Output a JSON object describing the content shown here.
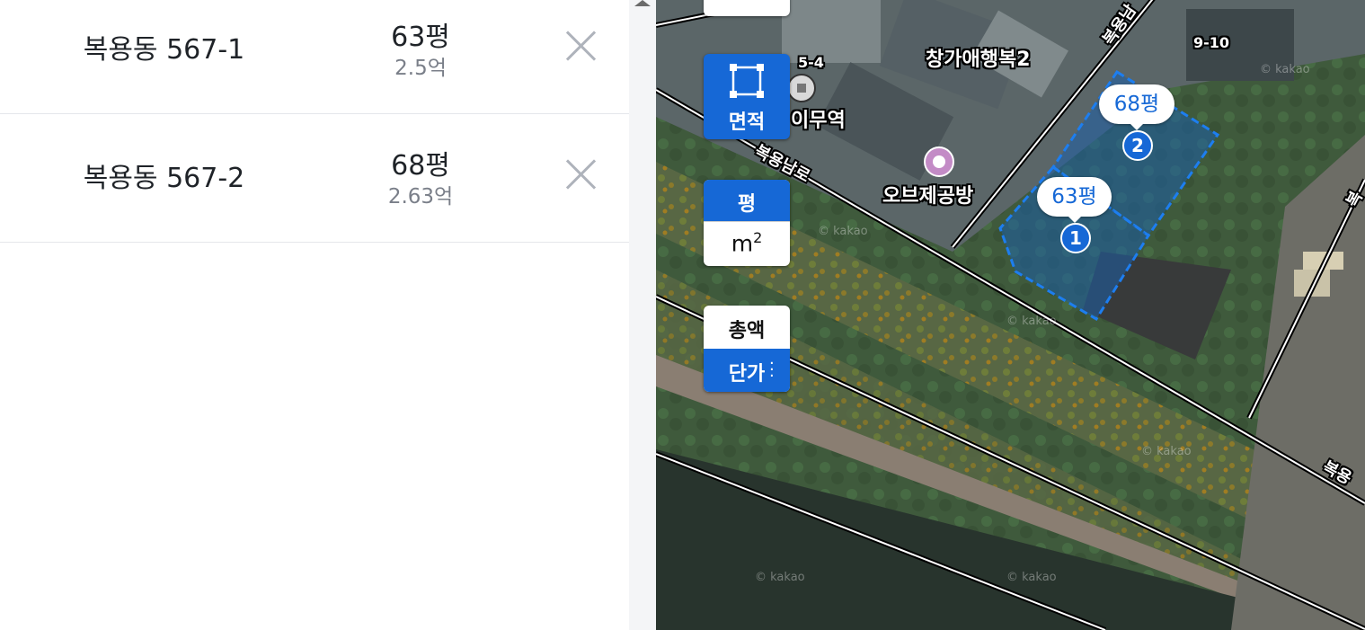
{
  "parcels": [
    {
      "address": "복용동 567-1",
      "area": "63평",
      "price": "2.5억"
    },
    {
      "address": "복용동 567-2",
      "area": "68평",
      "price": "2.63억"
    }
  ],
  "map": {
    "labels": {
      "road_name": "복용남로",
      "building_1": "창가애행복2",
      "station": "이무역",
      "art_place": "오브제공방",
      "lot_1": "5-4",
      "lot_2": "9-10",
      "road_right": "복용",
      "road_right_top": "복",
      "road_top": "복용남"
    },
    "selection_bubbles": [
      {
        "area": "63평",
        "number": "1"
      },
      {
        "area": "68평",
        "number": "2"
      }
    ],
    "watermarks": [
      "© kakao",
      "© kakao",
      "© kakao",
      "© kakao",
      "© kakao",
      "© kakao"
    ]
  },
  "controls": {
    "area_tool_label": "면적",
    "unit_pyeong": "평",
    "unit_m2_base": "m",
    "unit_m2_sup": "2",
    "total_label": "총액",
    "unit_price_label": "단가"
  },
  "colors": {
    "accent": "#1668d6",
    "selection_fill": "#1c5ea8",
    "panel_bg": "#ffffff"
  }
}
